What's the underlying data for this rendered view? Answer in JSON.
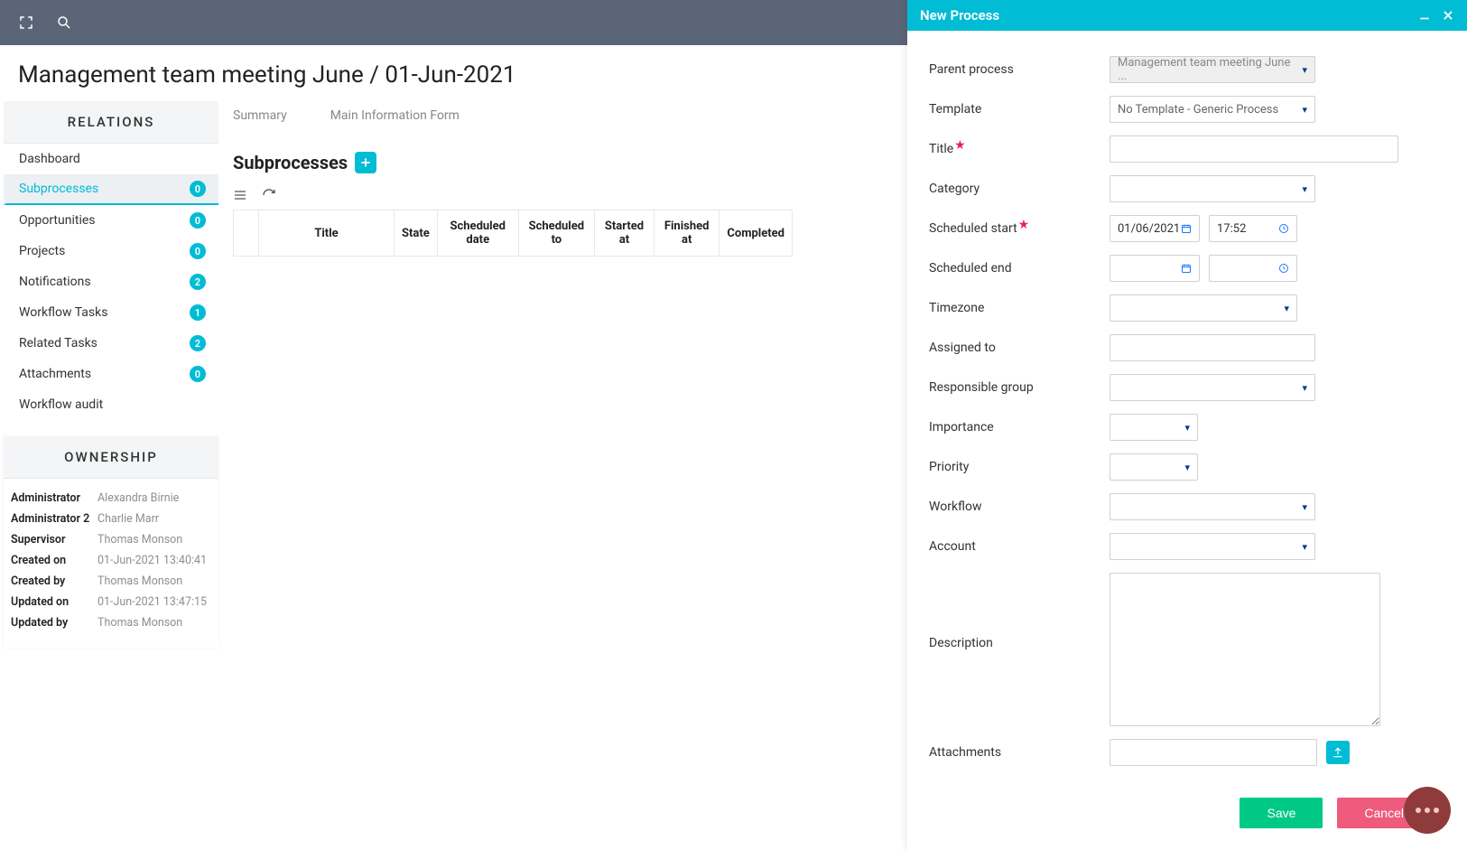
{
  "page_title": "Management team meeting June / 01-Jun-2021",
  "sidebar": {
    "relations_header": "RELATIONS",
    "items": [
      {
        "label": "Dashboard",
        "count": null
      },
      {
        "label": "Subprocesses",
        "count": "0",
        "active": true
      },
      {
        "label": "Opportunities",
        "count": "0"
      },
      {
        "label": "Projects",
        "count": "0"
      },
      {
        "label": "Notifications",
        "count": "2"
      },
      {
        "label": "Workflow Tasks",
        "count": "1"
      },
      {
        "label": "Related Tasks",
        "count": "2"
      },
      {
        "label": "Attachments",
        "count": "0"
      },
      {
        "label": "Workflow audit",
        "count": null
      }
    ],
    "ownership_header": "OWNERSHIP",
    "ownership": [
      {
        "label": "Administrator",
        "value": "Alexandra Birnie"
      },
      {
        "label": "Administrator 2",
        "value": "Charlie Marr"
      },
      {
        "label": "Supervisor",
        "value": "Thomas Monson"
      },
      {
        "label": "Created on",
        "value": "01-Jun-2021 13:40:41"
      },
      {
        "label": "Created by",
        "value": "Thomas Monson"
      },
      {
        "label": "Updated on",
        "value": "01-Jun-2021 13:47:15"
      },
      {
        "label": "Updated by",
        "value": "Thomas Monson"
      }
    ]
  },
  "tabs": [
    "Summary",
    "Main Information Form"
  ],
  "section_title": "Subprocesses",
  "table_columns": [
    "Title",
    "State",
    "Scheduled date",
    "Scheduled to",
    "Started at",
    "Finished at",
    "Completed"
  ],
  "panel": {
    "title": "New Process",
    "labels": {
      "parent_process": "Parent process",
      "template": "Template",
      "title": "Title",
      "category": "Category",
      "scheduled_start": "Scheduled start",
      "scheduled_end": "Scheduled end",
      "timezone": "Timezone",
      "assigned_to": "Assigned to",
      "responsible_group": "Responsible group",
      "importance": "Importance",
      "priority": "Priority",
      "workflow": "Workflow",
      "account": "Account",
      "description": "Description",
      "attachments": "Attachments"
    },
    "values": {
      "parent_process": "Management team meeting June ...",
      "template": "No Template - Generic Process",
      "scheduled_start_date": "01/06/2021",
      "scheduled_start_time": "17:52"
    },
    "buttons": {
      "save": "Save",
      "cancel": "Cancel"
    }
  }
}
